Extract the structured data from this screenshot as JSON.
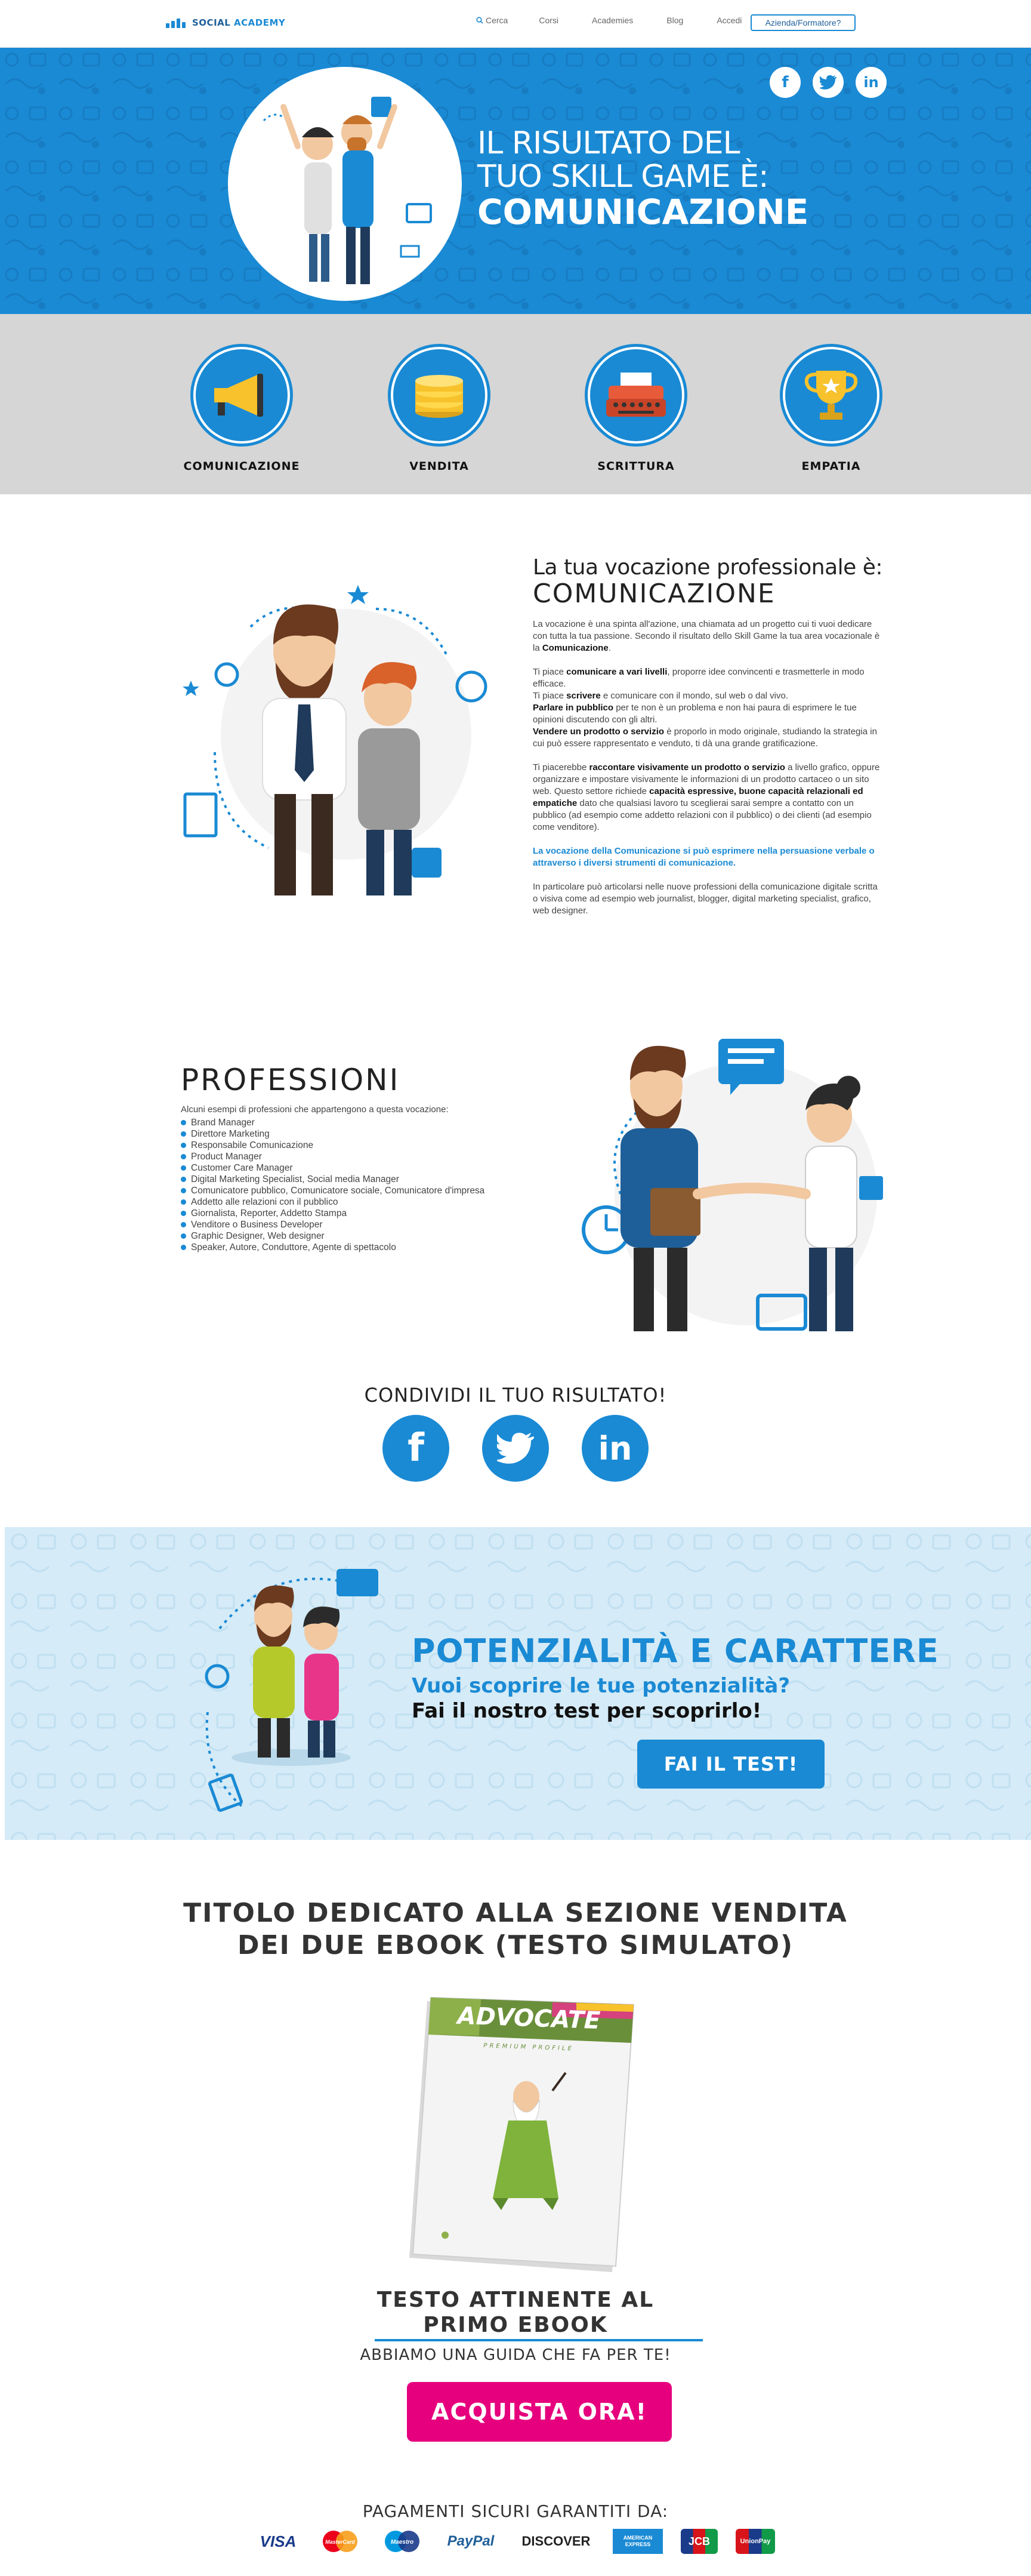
{
  "nav": {
    "logo_part1": "SOCIAL",
    "logo_part2": "ACADEMY",
    "items": [
      "Cerca",
      "Corsi",
      "Academies",
      "Blog",
      "Accedi"
    ],
    "cta": "Azienda/Formatore?"
  },
  "hero": {
    "title_line1": "IL RISULTATO DEL",
    "title_line2": "TUO SKILL GAME È:",
    "title_line3": "COMUNICAZIONE",
    "social": [
      "facebook-icon",
      "twitter-icon",
      "linkedin-icon"
    ]
  },
  "skills": [
    {
      "label": "COMUNICAZIONE",
      "icon": "megaphone-icon"
    },
    {
      "label": "VENDITA",
      "icon": "coins-icon"
    },
    {
      "label": "SCRITTURA",
      "icon": "typewriter-icon"
    },
    {
      "label": "EMPATIA",
      "icon": "trophy-icon"
    }
  ],
  "vocazione": {
    "heading": "La tua vocazione professionale è:",
    "subheading": "COMUNICAZIONE",
    "p1_a": "La vocazione è una spinta all'azione, una chiamata ad un progetto cui ti vuoi dedicare con tutta la tua passione. Secondo il risultato dello Skill Game la tua area vocazionale è la ",
    "p1_b": "Comunicazione",
    "p1_c": ".",
    "p2_a": "Ti piace ",
    "p2_b": "comunicare a vari livelli",
    "p2_c": ", proporre idee convincenti e trasmetterle in modo efficace.",
    "p2_d": "Ti piace ",
    "p2_e": "scrivere",
    "p2_f": " e comunicare con il mondo, sul web o dal vivo.",
    "p2_g": "Parlare in pubblico",
    "p2_h": " per te non è un problema e non hai paura di esprimere le tue opinioni discutendo con gli altri.",
    "p2_i": "Vendere un prodotto o servizio",
    "p2_j": " è proporlo in modo originale, studiando la strategia in cui può essere rappresentato e venduto, ti dà una grande gratificazione.",
    "p3_a": "Ti piacerebbe ",
    "p3_b": "raccontare visivamente un prodotto o servizio",
    "p3_c": " a livello grafico, oppure organizzare e impostare visivamente le informazioni di un prodotto cartaceo o un sito web. Questo settore richiede ",
    "p3_d": "capacità espressive, buone capacità relazionali ed empatiche",
    "p3_e": " dato che qualsiasi lavoro tu sceglierai sarai sempre a contatto con un pubblico (ad esempio come addetto relazioni con il pubblico) o dei clienti (ad esempio come venditore).",
    "p4": "La vocazione della Comunicazione si può esprimere nella persuasione verbale o attraverso i diversi strumenti di comunicazione.",
    "p5": "In particolare può articolarsi nelle nuove professioni della comunicazione digitale scritta o visiva come ad esempio web journalist, blogger, digital marketing specialist, grafico, web designer."
  },
  "professioni": {
    "heading": "PROFESSIONI",
    "intro": "Alcuni esempi di professioni che appartengono a questa vocazione:",
    "items": [
      "Brand Manager",
      "Direttore Marketing",
      "Responsabile Comunicazione",
      "Product Manager",
      "Customer Care Manager",
      "Digital Marketing Specialist, Social media Manager",
      "Comunicatore pubblico, Comunicatore sociale, Comunicatore d'impresa",
      "Addetto alle relazioni con il pubblico",
      "Giornalista, Reporter, Addetto Stampa",
      "Venditore o Business Developer",
      "Graphic Designer, Web designer",
      "Speaker, Autore, Conduttore, Agente di spettacolo"
    ]
  },
  "share": {
    "heading": "CONDIVIDI IL TUO RISULTATO!",
    "icons": [
      "facebook-icon",
      "twitter-icon",
      "linkedin-icon"
    ]
  },
  "potenzialita": {
    "heading": "POTENZIALITÀ E CARATTERE",
    "line1": "Vuoi scoprire le tue potenzialità?",
    "line2": "Fai il nostro test per scoprirlo!",
    "button": "FAI IL TEST!"
  },
  "ebook": {
    "title_line1": "TITOLO DEDICATO ALLA SEZIONE VENDITA",
    "title_line2": "DEI DUE EBOOK (TESTO SIMULATO)",
    "book_title": "ADVOCATE",
    "book_subtitle": "PREMIUM PROFILE",
    "subtitle_line1": "TESTO ATTINENTE AL",
    "subtitle_line2": "PRIMO EBOOK",
    "guide": "ABBIAMO UNA GUIDA CHE FA PER TE!",
    "button": "ACQUISTA ORA!"
  },
  "payments": {
    "heading": "PAGAMENTI SICURI GARANTITI DA:",
    "cards": [
      "VISA",
      "MasterCard",
      "Maestro",
      "PayPal",
      "DISCOVER",
      "AMERICAN EXPRESS",
      "JCB",
      "UnionPay"
    ]
  },
  "colors": {
    "brand_blue": "#1a8ad4",
    "cta_pink": "#e6007e",
    "skills_bg": "#d6d6d6",
    "banner_bg": "#d5ebf7"
  }
}
